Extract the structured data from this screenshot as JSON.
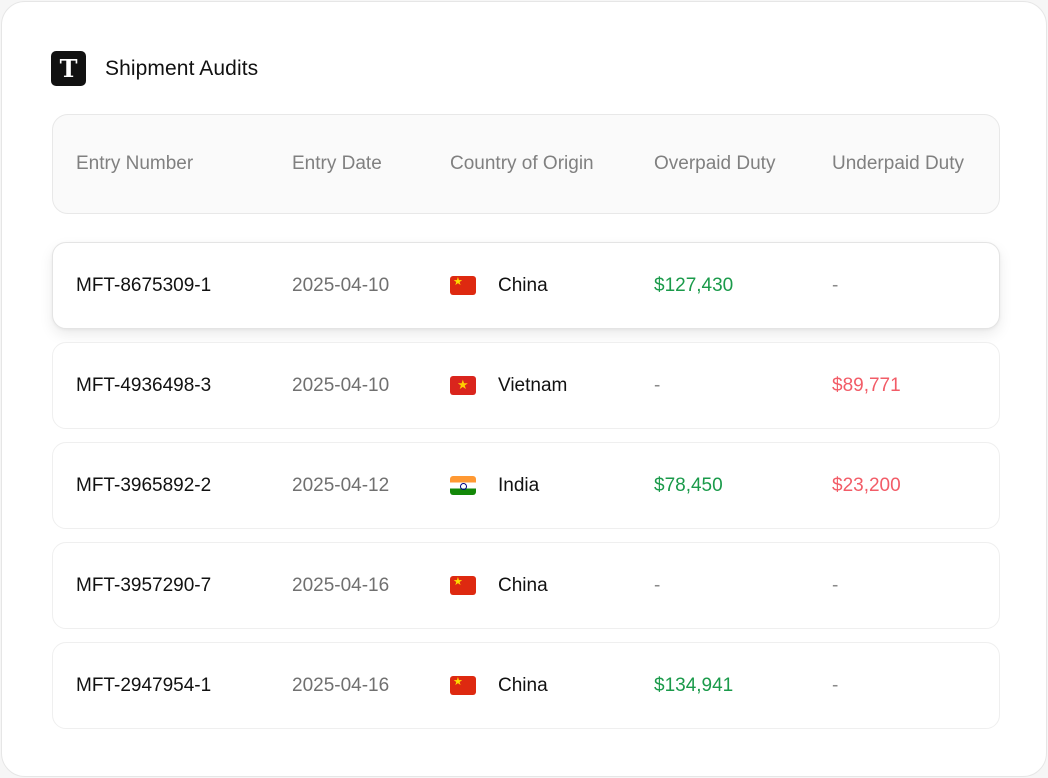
{
  "app": {
    "logo_letter": "T",
    "title": "Shipment Audits"
  },
  "table": {
    "columns": [
      "Entry Number",
      "Entry Date",
      "Country of Origin",
      "Overpaid Duty",
      "Underpaid Duty"
    ],
    "rows": [
      {
        "entry": "MFT-8675309-1",
        "date": "2025-04-10",
        "country": "China",
        "flag_icon": "china-flag-icon",
        "overpaid": "$127,430",
        "underpaid": "-"
      },
      {
        "entry": "MFT-4936498-3",
        "date": "2025-04-10",
        "country": "Vietnam",
        "flag_icon": "vietnam-flag-icon",
        "overpaid": "-",
        "underpaid": "$89,771"
      },
      {
        "entry": "MFT-3965892-2",
        "date": "2025-04-12",
        "country": "India",
        "flag_icon": "india-flag-icon",
        "overpaid": "$78,450",
        "underpaid": "$23,200"
      },
      {
        "entry": "MFT-3957290-7",
        "date": "2025-04-16",
        "country": "China",
        "flag_icon": "china-flag-icon",
        "overpaid": "-",
        "underpaid": "-"
      },
      {
        "entry": "MFT-2947954-1",
        "date": "2025-04-16",
        "country": "China",
        "flag_icon": "china-flag-icon",
        "overpaid": "$134,941",
        "underpaid": "-"
      }
    ]
  },
  "colors": {
    "overpaid": "#1a9a4a",
    "underpaid": "#f25c67"
  }
}
